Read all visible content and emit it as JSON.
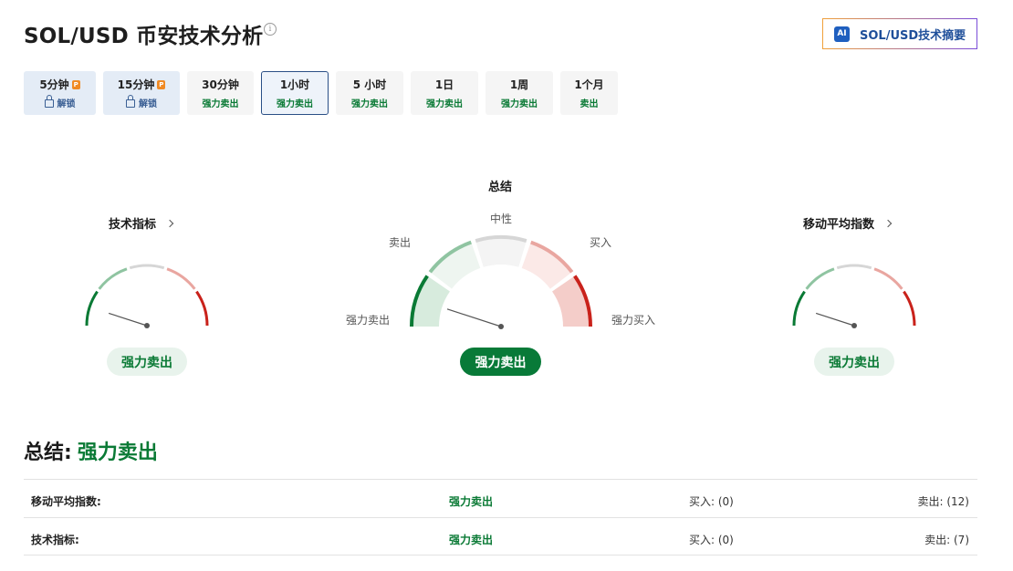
{
  "page": {
    "title": "SOL/USD 币安技术分析",
    "info_icon": "i",
    "ai_button": {
      "badge": "AI",
      "label": "SOL/USD技术摘要"
    }
  },
  "tabs": [
    {
      "label": "5分钟",
      "sub": "解锁",
      "locked": true
    },
    {
      "label": "15分钟",
      "sub": "解锁",
      "locked": true
    },
    {
      "label": "30分钟",
      "sub": "强力卖出",
      "locked": false
    },
    {
      "label": "1小时",
      "sub": "强力卖出",
      "locked": false,
      "active": true
    },
    {
      "label": "5 小时",
      "sub": "强力卖出",
      "locked": false
    },
    {
      "label": "1日",
      "sub": "强力卖出",
      "locked": false
    },
    {
      "label": "1周",
      "sub": "强力卖出",
      "locked": false
    },
    {
      "label": "1个月",
      "sub": "卖出",
      "locked": false
    }
  ],
  "pro_badge": "P",
  "gauges": {
    "technical": {
      "title": "技术指标",
      "result": "强力卖出",
      "needle_level": 0.1
    },
    "summary": {
      "title": "总结",
      "result": "强力卖出",
      "needle_level": 0.1,
      "labels": {
        "strong_sell": "强力卖出",
        "sell": "卖出",
        "neutral": "中性",
        "buy": "买入",
        "strong_buy": "强力买入"
      }
    },
    "moving_averages": {
      "title": "移动平均指数",
      "result": "强力卖出",
      "needle_level": 0.1
    }
  },
  "summary": {
    "label": "总结:",
    "value": "强力卖出"
  },
  "table": [
    {
      "name": "移动平均指数:",
      "signal": "强力卖出",
      "buy": "买入: (0)",
      "sell": "卖出: (12)"
    },
    {
      "name": "技术指标:",
      "signal": "强力卖出",
      "buy": "买入: (0)",
      "sell": "卖出: (7)"
    }
  ],
  "colors": {
    "strong_sell": "#0a7a35",
    "sell": "#8fc4a1",
    "neutral": "#d6d6d6",
    "buy": "#e9a6a0",
    "strong_buy": "#c9221b",
    "brand_blue": "#2a4f86"
  }
}
